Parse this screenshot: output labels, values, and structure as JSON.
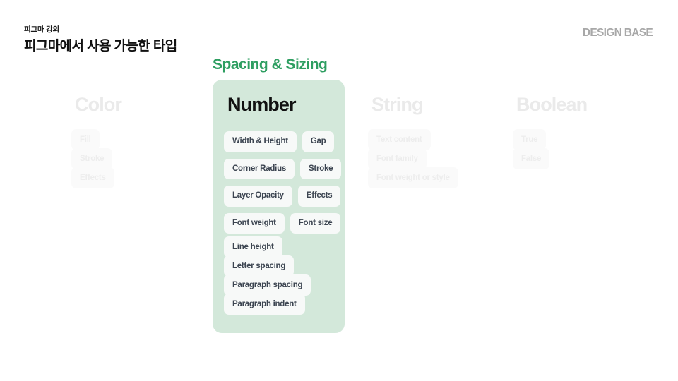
{
  "header": {
    "eyebrow": "피그마 강의",
    "title": "피그마에서 사용 가능한 타입",
    "brand": "DESIGN BASE"
  },
  "section_label": "Spacing & Sizing",
  "colors": {
    "accent_green": "#2E9E61",
    "card_mint": "#D3E8DA",
    "chip_bg": "#F7F9F8",
    "chip_text": "#3B4450",
    "ghost_text": "#EAEAEA",
    "brand_grey": "#A8A8A8"
  },
  "columns": [
    {
      "id": "color",
      "title": "Color",
      "state": "dimmed",
      "chips": [
        "Fill",
        "Stroke",
        "Effects"
      ]
    },
    {
      "id": "number",
      "title": "Number",
      "state": "active",
      "chips": [
        "Width & Height",
        "Gap",
        "Corner Radius",
        "Stroke",
        "Layer Opacity",
        "Effects",
        "Font weight",
        "Font size",
        "Line height",
        "Letter spacing",
        "Paragraph spacing",
        "Paragraph indent"
      ]
    },
    {
      "id": "string",
      "title": "String",
      "state": "dimmed",
      "chips": [
        "Text content",
        "Font family",
        "Font weight or style"
      ]
    },
    {
      "id": "boolean",
      "title": "Boolean",
      "state": "dimmed",
      "chips": [
        "True",
        "False"
      ]
    }
  ]
}
